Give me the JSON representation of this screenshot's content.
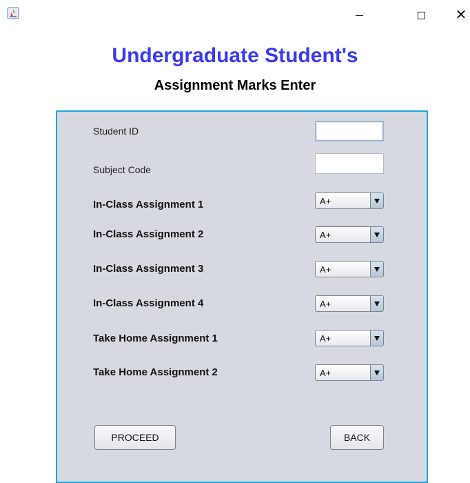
{
  "window": {
    "minimize_glyph": "minimize-icon",
    "maximize_glyph": "maximize-icon",
    "close_glyph": "✕"
  },
  "header": {
    "title": "Undergraduate Student's",
    "subtitle": "Assignment Marks Enter"
  },
  "form": {
    "student_id": {
      "label": "Student ID",
      "value": ""
    },
    "subject_code": {
      "label": "Subject Code",
      "value": ""
    },
    "assignments": [
      {
        "label": "In-Class Assignment 1",
        "selected": "A+"
      },
      {
        "label": "In-Class Assignment 2",
        "selected": "A+"
      },
      {
        "label": "In-Class Assignment 3",
        "selected": "A+"
      },
      {
        "label": "In-Class Assignment 4",
        "selected": "A+"
      },
      {
        "label": "Take Home Assignment 1",
        "selected": "A+"
      },
      {
        "label": "Take Home Assignment 2",
        "selected": "A+"
      }
    ]
  },
  "buttons": {
    "proceed": "PROCEED",
    "back": "BACK"
  },
  "colors": {
    "title": "#3a3af0",
    "panel_bg": "#d6d9e0",
    "panel_border": "#1ba9dd"
  }
}
